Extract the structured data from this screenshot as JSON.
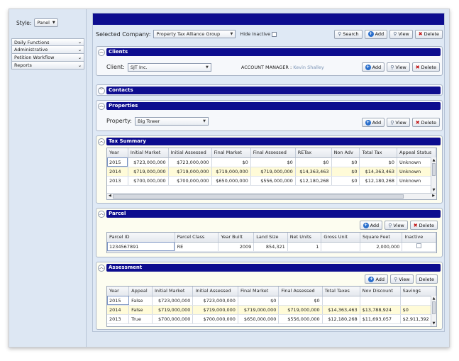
{
  "sidebar": {
    "style_label": "Style:",
    "style_value": "Panel",
    "menu": [
      {
        "label": "Daily Functions"
      },
      {
        "label": "Administrative"
      },
      {
        "label": "Petition Workflow"
      },
      {
        "label": "Reports"
      }
    ]
  },
  "header": {
    "company_label": "Selected Company:",
    "company_value": "Property Tax Alliance Group",
    "hide_inactive_label": "Hide Inactive",
    "search_label": "Search",
    "add_label": "Add",
    "view_label": "View",
    "delete_label": "Delete"
  },
  "clients": {
    "title": "Clients",
    "client_label": "Client:",
    "client_value": "SJT Inc.",
    "account_manager_label": "ACCOUNT MANAGER :",
    "account_manager_value": "Kevin Shalley",
    "add_label": "Add",
    "view_label": "View",
    "delete_label": "Delete"
  },
  "contacts": {
    "title": "Contacts"
  },
  "properties": {
    "title": "Properties",
    "property_label": "Property:",
    "property_value": "Big Tower",
    "add_label": "Add",
    "view_label": "View",
    "delete_label": "Delete"
  },
  "tax_summary": {
    "title": "Tax Summary",
    "columns": [
      "Year",
      "Initial Market",
      "Initial Assessed",
      "Final Market",
      "Final Assessed",
      "RETax",
      "Non Adv",
      "Total Tax",
      "Appeal Status"
    ],
    "rows": [
      [
        "2015",
        "$723,000,000",
        "$723,000,000",
        "$0",
        "$0",
        "$0",
        "$0",
        "$0",
        "Unknown"
      ],
      [
        "2014",
        "$719,000,000",
        "$719,000,000",
        "$719,000,000",
        "$719,000,000",
        "$14,363,463",
        "$0",
        "$14,363,463",
        "Unknown"
      ],
      [
        "2013",
        "$700,000,000",
        "$700,000,000",
        "$650,000,000",
        "$556,000,000",
        "$12,180,268",
        "$0",
        "$12,180,268",
        "Unknown"
      ]
    ]
  },
  "parcel": {
    "title": "Parcel",
    "add_label": "Add",
    "view_label": "View",
    "delete_label": "Delete",
    "columns": [
      "Parcel ID",
      "Parcel Class",
      "Year Built",
      "Land Size",
      "Net Units",
      "Gross Unit",
      "Square Feet",
      "Inactive"
    ],
    "rows": [
      [
        "1234567891",
        "RE",
        "2009",
        "854,321",
        "1",
        "",
        "2,000,000",
        ""
      ]
    ]
  },
  "assessment": {
    "title": "Assessment",
    "add_label": "Add",
    "view_label": "View",
    "delete_label": "Delete",
    "columns": [
      "Year",
      "Appeal",
      "Initial Market",
      "Initial Assessed",
      "Final Market",
      "Final Assessed",
      "Total Taxes",
      "Nov Discount",
      "Savings"
    ],
    "rows": [
      [
        "2015",
        "False",
        "$723,000,000",
        "$723,000,000",
        "$0",
        "$0",
        "",
        "",
        ""
      ],
      [
        "2014",
        "False",
        "$719,000,000",
        "$719,000,000",
        "$719,000,000",
        "$719,000,000",
        "$14,363,463",
        "$13,788,924",
        "$0"
      ],
      [
        "2013",
        "True",
        "$700,000,000",
        "$700,000,000",
        "$650,000,000",
        "$556,000,000",
        "$12,180,268",
        "$11,693,057",
        "$2,911,392"
      ]
    ]
  }
}
